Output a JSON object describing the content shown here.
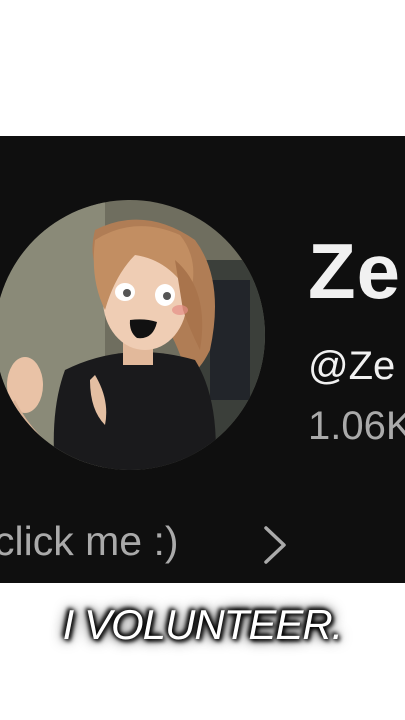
{
  "profile": {
    "channel_name": "Ze",
    "handle": "@Ze",
    "subscribers": "1.06K",
    "description": "click me :)"
  },
  "caption": "I VOLUNTEER.",
  "icons": {
    "chevron": "chevron-right-icon"
  },
  "colors": {
    "card_background": "#0f0f0f",
    "primary_text": "#f1f1f1",
    "secondary_text": "#aaaaaa",
    "page_background": "#ffffff"
  }
}
